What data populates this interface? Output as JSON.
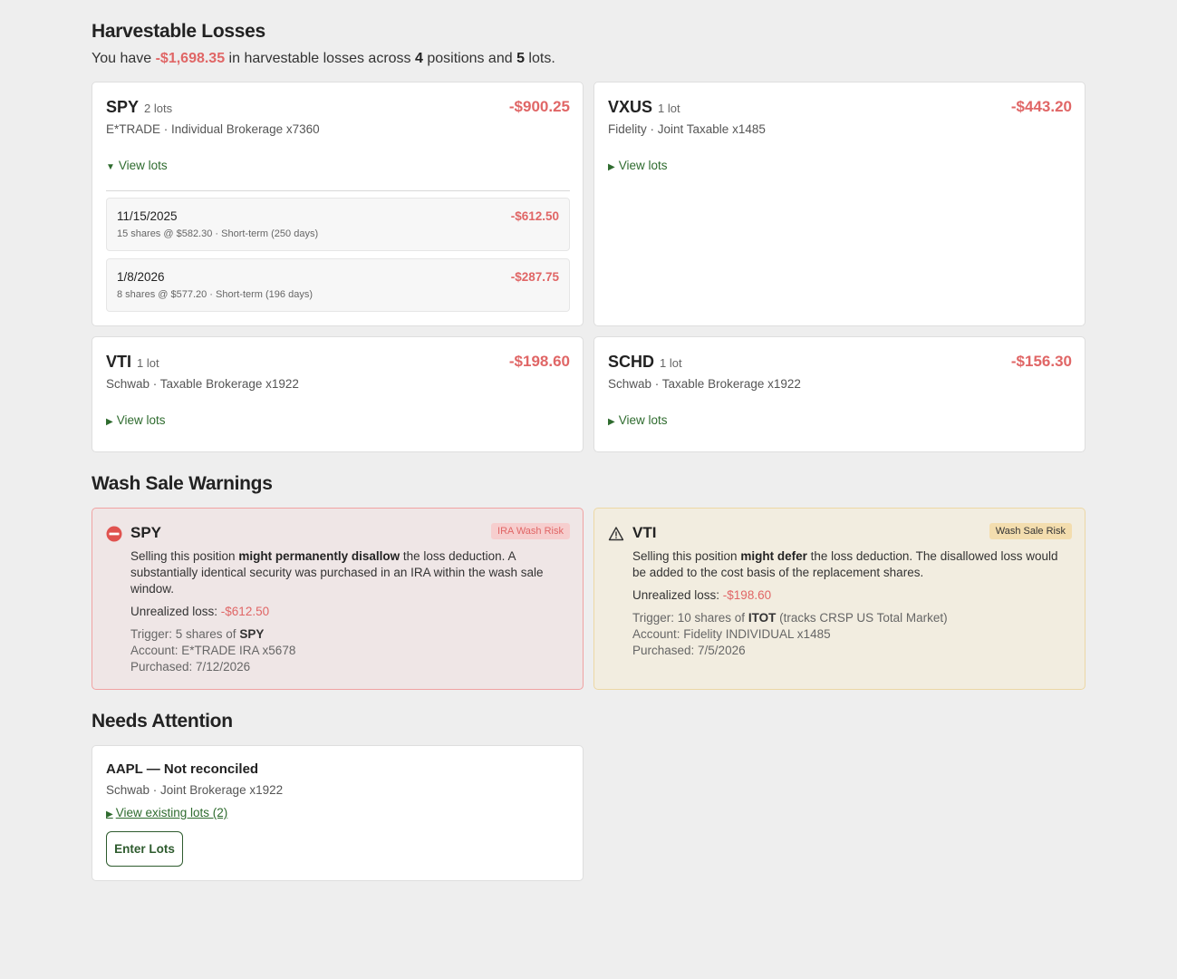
{
  "harvestable": {
    "title": "Harvestable Losses",
    "summary": {
      "prefix": "You have ",
      "total": "-$1,698.35",
      "mid1": " in harvestable losses across ",
      "positions": "4",
      "mid2": " positions and ",
      "lots": "5",
      "suffix": " lots."
    },
    "cards": [
      {
        "ticker": "SPY",
        "lots": "2 lots",
        "amount": "-$900.25",
        "account": "E*TRADE · Individual Brokerage x7360",
        "toggle_icon": "▼",
        "toggle_label": "View lots",
        "lot_rows": [
          {
            "date": "11/15/2025",
            "detail": "15 shares @ $582.30 · Short-term (250 days)",
            "amount": "-$612.50"
          },
          {
            "date": "1/8/2026",
            "detail": "8 shares @ $577.20 · Short-term (196 days)",
            "amount": "-$287.75"
          }
        ]
      },
      {
        "ticker": "VXUS",
        "lots": "1 lot",
        "amount": "-$443.20",
        "account": "Fidelity · Joint Taxable x1485",
        "toggle_icon": "▶",
        "toggle_label": "View lots"
      },
      {
        "ticker": "VTI",
        "lots": "1 lot",
        "amount": "-$198.60",
        "account": "Schwab · Taxable Brokerage x1922",
        "toggle_icon": "▶",
        "toggle_label": "View lots"
      },
      {
        "ticker": "SCHD",
        "lots": "1 lot",
        "amount": "-$156.30",
        "account": "Schwab · Taxable Brokerage x1922",
        "toggle_icon": "▶",
        "toggle_label": "View lots"
      }
    ]
  },
  "wash": {
    "title": "Wash Sale Warnings",
    "warnings": [
      {
        "icon": "no-entry-icon",
        "ticker": "SPY",
        "badge": "IRA Wash Risk",
        "text_a": "Selling this position ",
        "text_bold": "might permanently disallow",
        "text_b": " the loss deduction. A substantially identical security was purchased in an IRA within the wash sale window.",
        "unrealized_label": "Unrealized loss: ",
        "unrealized_value": "-$612.50",
        "trigger_prefix": "Trigger: 5 shares of ",
        "trigger_ticker": "SPY",
        "trigger_suffix": "",
        "account": "Account: E*TRADE IRA x5678",
        "purchased": "Purchased: 7/12/2026",
        "color": "#e06666"
      },
      {
        "icon": "warning-triangle-icon",
        "ticker": "VTI",
        "badge": "Wash Sale Risk",
        "text_a": "Selling this position ",
        "text_bold": "might defer",
        "text_b": " the loss deduction. The disallowed loss would be added to the cost basis of the replacement shares.",
        "unrealized_label": "Unrealized loss: ",
        "unrealized_value": "-$198.60",
        "trigger_prefix": "Trigger: 10 shares of ",
        "trigger_ticker": "ITOT",
        "trigger_suffix": " (tracks CRSP US Total Market)",
        "account": "Account: Fidelity INDIVIDUAL x1485",
        "purchased": "Purchased: 7/5/2026",
        "color": "#d9a441"
      }
    ]
  },
  "attention": {
    "title": "Needs Attention",
    "item": {
      "heading": "AAPL — Not reconciled",
      "account": "Schwab · Joint Brokerage x1922",
      "link_icon": "▶",
      "link": "View existing lots (2)",
      "button": "Enter Lots"
    }
  },
  "colors": {
    "loss": "#e06666",
    "link": "#2e6b2e",
    "background": "#eeeeee"
  }
}
